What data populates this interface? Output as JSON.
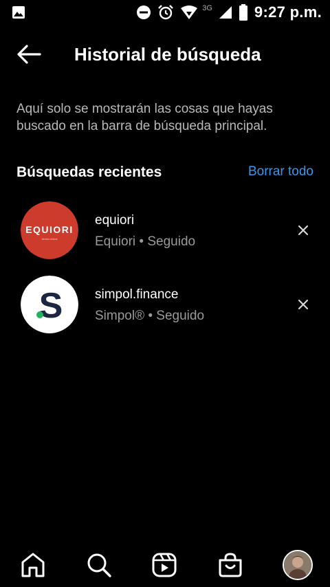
{
  "status_bar": {
    "network": "3G",
    "time": "9:27 p.m."
  },
  "header": {
    "title": "Historial de búsqueda"
  },
  "info_text": "Aquí solo se mostrarán las cosas que hayas buscado en la barra de búsqueda principal.",
  "recent": {
    "title": "Búsquedas recientes",
    "clear_label": "Borrar todo",
    "items": [
      {
        "username": "equiori",
        "subtitle": "Equiori • Seguido",
        "logo_text": "EQUIORI",
        "logo_tagline": "tienda virtual",
        "logo_bg": "#cc3b2c"
      },
      {
        "username": "simpol.finance",
        "subtitle": "Simpol® • Seguido",
        "logo_text": "S",
        "logo_bg": "#ffffff"
      }
    ]
  },
  "colors": {
    "background": "#000000",
    "accent": "#3797f0",
    "secondary_text": "#9a9a9a"
  }
}
